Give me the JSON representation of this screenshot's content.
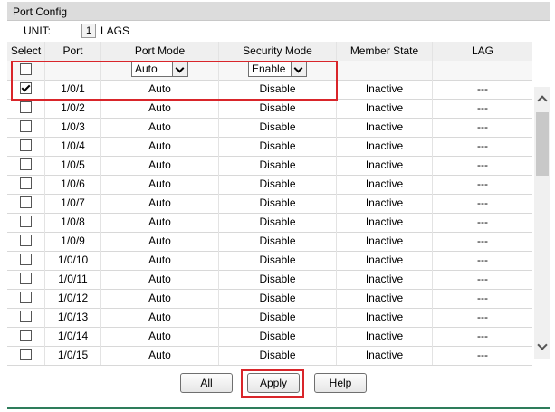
{
  "panel": {
    "title": "Port Config"
  },
  "unit": {
    "label": "UNIT:",
    "value": "1",
    "lags_label": "LAGS"
  },
  "table": {
    "headers": {
      "select": "Select",
      "port": "Port",
      "port_mode": "Port Mode",
      "security_mode": "Security Mode",
      "member_state": "Member State",
      "lag": "LAG"
    },
    "edit_row": {
      "port_mode": "Auto",
      "security_mode": "Enable"
    },
    "rows": [
      {
        "port": "1/0/1",
        "mode": "Auto",
        "security": "Disable",
        "state": "Inactive",
        "lag": "---",
        "checked": true
      },
      {
        "port": "1/0/2",
        "mode": "Auto",
        "security": "Disable",
        "state": "Inactive",
        "lag": "---",
        "checked": false
      },
      {
        "port": "1/0/3",
        "mode": "Auto",
        "security": "Disable",
        "state": "Inactive",
        "lag": "---",
        "checked": false
      },
      {
        "port": "1/0/4",
        "mode": "Auto",
        "security": "Disable",
        "state": "Inactive",
        "lag": "---",
        "checked": false
      },
      {
        "port": "1/0/5",
        "mode": "Auto",
        "security": "Disable",
        "state": "Inactive",
        "lag": "---",
        "checked": false
      },
      {
        "port": "1/0/6",
        "mode": "Auto",
        "security": "Disable",
        "state": "Inactive",
        "lag": "---",
        "checked": false
      },
      {
        "port": "1/0/7",
        "mode": "Auto",
        "security": "Disable",
        "state": "Inactive",
        "lag": "---",
        "checked": false
      },
      {
        "port": "1/0/8",
        "mode": "Auto",
        "security": "Disable",
        "state": "Inactive",
        "lag": "---",
        "checked": false
      },
      {
        "port": "1/0/9",
        "mode": "Auto",
        "security": "Disable",
        "state": "Inactive",
        "lag": "---",
        "checked": false
      },
      {
        "port": "1/0/10",
        "mode": "Auto",
        "security": "Disable",
        "state": "Inactive",
        "lag": "---",
        "checked": false
      },
      {
        "port": "1/0/11",
        "mode": "Auto",
        "security": "Disable",
        "state": "Inactive",
        "lag": "---",
        "checked": false
      },
      {
        "port": "1/0/12",
        "mode": "Auto",
        "security": "Disable",
        "state": "Inactive",
        "lag": "---",
        "checked": false
      },
      {
        "port": "1/0/13",
        "mode": "Auto",
        "security": "Disable",
        "state": "Inactive",
        "lag": "---",
        "checked": false
      },
      {
        "port": "1/0/14",
        "mode": "Auto",
        "security": "Disable",
        "state": "Inactive",
        "lag": "---",
        "checked": false
      },
      {
        "port": "1/0/15",
        "mode": "Auto",
        "security": "Disable",
        "state": "Inactive",
        "lag": "---",
        "checked": false
      }
    ]
  },
  "buttons": {
    "all": "All",
    "apply": "Apply",
    "help": "Help"
  },
  "colors": {
    "highlight": "#d9252a",
    "footer_line": "#2e7d5b"
  }
}
